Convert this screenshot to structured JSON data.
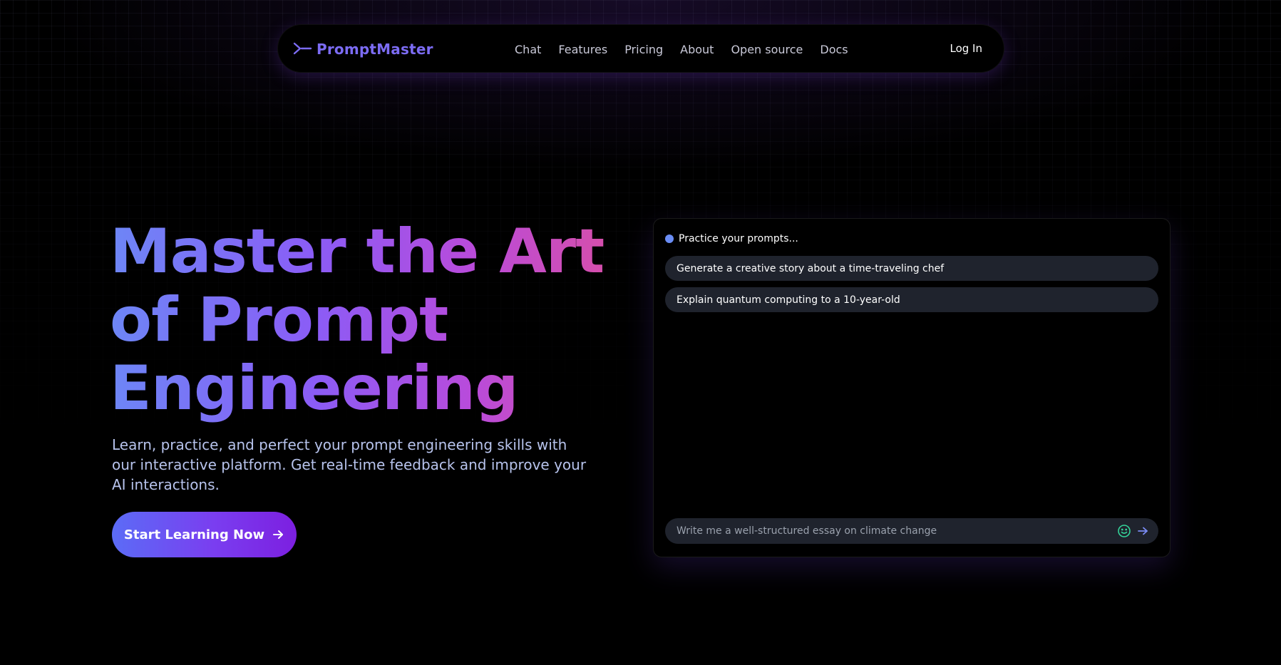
{
  "nav": {
    "brand": "PromptMaster",
    "brand_icon": "terminal-prompt-icon",
    "links": [
      "Chat",
      "Features",
      "Pricing",
      "About",
      "Open source",
      "Docs"
    ],
    "login": "Log In"
  },
  "hero": {
    "title_lines": [
      "Master the Art",
      "of Prompt",
      "Engineering"
    ],
    "subtitle": "Learn, practice, and perfect your prompt engineering skills with our interactive platform. Get real-time feedback and improve your AI interactions.",
    "cta_label": "Start Learning Now",
    "cta_icon": "arrow-right-icon"
  },
  "chat": {
    "title": "Practice your prompts...",
    "suggestions": [
      "Generate a creative story about a time-traveling chef",
      "Explain quantum computing to a 10-year-old"
    ],
    "input_value": "",
    "input_placeholder": "Write me a well-structured essay on climate change",
    "emoji_icon": "smiley-icon",
    "send_icon": "send-arrow-icon"
  },
  "colors": {
    "background": "#000000",
    "brand": "#7c6cf4",
    "title_gradient": [
      "#6d86f6",
      "#8b5cf6",
      "#b84bdb",
      "#d94fa6"
    ],
    "cta_gradient": [
      "#5b6cf6",
      "#7c1fe0"
    ],
    "status_dot": "#6a8df5",
    "chip_bg": "#1f232d",
    "emoji_icon": "#34d399",
    "send_icon": "#7b8cf5"
  }
}
